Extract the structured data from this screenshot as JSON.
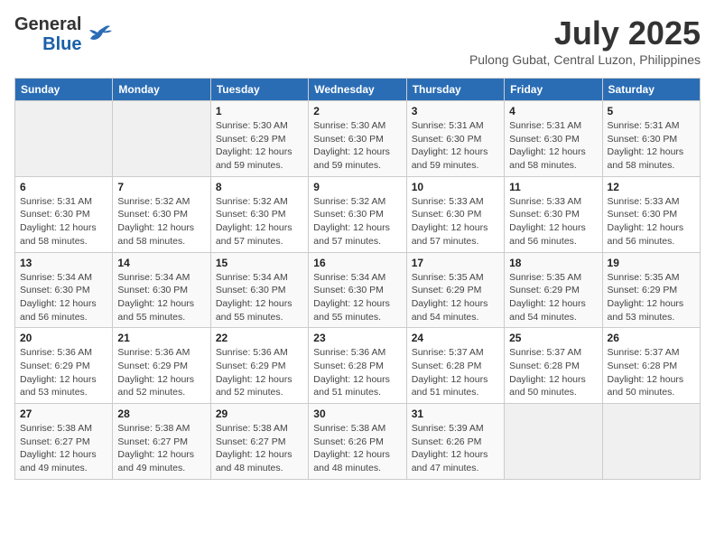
{
  "header": {
    "logo_line1": "General",
    "logo_line2": "Blue",
    "month_year": "July 2025",
    "location": "Pulong Gubat, Central Luzon, Philippines"
  },
  "days_of_week": [
    "Sunday",
    "Monday",
    "Tuesday",
    "Wednesday",
    "Thursday",
    "Friday",
    "Saturday"
  ],
  "weeks": [
    [
      {
        "day": "",
        "detail": ""
      },
      {
        "day": "",
        "detail": ""
      },
      {
        "day": "1",
        "detail": "Sunrise: 5:30 AM\nSunset: 6:29 PM\nDaylight: 12 hours\nand 59 minutes."
      },
      {
        "day": "2",
        "detail": "Sunrise: 5:30 AM\nSunset: 6:30 PM\nDaylight: 12 hours\nand 59 minutes."
      },
      {
        "day": "3",
        "detail": "Sunrise: 5:31 AM\nSunset: 6:30 PM\nDaylight: 12 hours\nand 59 minutes."
      },
      {
        "day": "4",
        "detail": "Sunrise: 5:31 AM\nSunset: 6:30 PM\nDaylight: 12 hours\nand 58 minutes."
      },
      {
        "day": "5",
        "detail": "Sunrise: 5:31 AM\nSunset: 6:30 PM\nDaylight: 12 hours\nand 58 minutes."
      }
    ],
    [
      {
        "day": "6",
        "detail": "Sunrise: 5:31 AM\nSunset: 6:30 PM\nDaylight: 12 hours\nand 58 minutes."
      },
      {
        "day": "7",
        "detail": "Sunrise: 5:32 AM\nSunset: 6:30 PM\nDaylight: 12 hours\nand 58 minutes."
      },
      {
        "day": "8",
        "detail": "Sunrise: 5:32 AM\nSunset: 6:30 PM\nDaylight: 12 hours\nand 57 minutes."
      },
      {
        "day": "9",
        "detail": "Sunrise: 5:32 AM\nSunset: 6:30 PM\nDaylight: 12 hours\nand 57 minutes."
      },
      {
        "day": "10",
        "detail": "Sunrise: 5:33 AM\nSunset: 6:30 PM\nDaylight: 12 hours\nand 57 minutes."
      },
      {
        "day": "11",
        "detail": "Sunrise: 5:33 AM\nSunset: 6:30 PM\nDaylight: 12 hours\nand 56 minutes."
      },
      {
        "day": "12",
        "detail": "Sunrise: 5:33 AM\nSunset: 6:30 PM\nDaylight: 12 hours\nand 56 minutes."
      }
    ],
    [
      {
        "day": "13",
        "detail": "Sunrise: 5:34 AM\nSunset: 6:30 PM\nDaylight: 12 hours\nand 56 minutes."
      },
      {
        "day": "14",
        "detail": "Sunrise: 5:34 AM\nSunset: 6:30 PM\nDaylight: 12 hours\nand 55 minutes."
      },
      {
        "day": "15",
        "detail": "Sunrise: 5:34 AM\nSunset: 6:30 PM\nDaylight: 12 hours\nand 55 minutes."
      },
      {
        "day": "16",
        "detail": "Sunrise: 5:34 AM\nSunset: 6:30 PM\nDaylight: 12 hours\nand 55 minutes."
      },
      {
        "day": "17",
        "detail": "Sunrise: 5:35 AM\nSunset: 6:29 PM\nDaylight: 12 hours\nand 54 minutes."
      },
      {
        "day": "18",
        "detail": "Sunrise: 5:35 AM\nSunset: 6:29 PM\nDaylight: 12 hours\nand 54 minutes."
      },
      {
        "day": "19",
        "detail": "Sunrise: 5:35 AM\nSunset: 6:29 PM\nDaylight: 12 hours\nand 53 minutes."
      }
    ],
    [
      {
        "day": "20",
        "detail": "Sunrise: 5:36 AM\nSunset: 6:29 PM\nDaylight: 12 hours\nand 53 minutes."
      },
      {
        "day": "21",
        "detail": "Sunrise: 5:36 AM\nSunset: 6:29 PM\nDaylight: 12 hours\nand 52 minutes."
      },
      {
        "day": "22",
        "detail": "Sunrise: 5:36 AM\nSunset: 6:29 PM\nDaylight: 12 hours\nand 52 minutes."
      },
      {
        "day": "23",
        "detail": "Sunrise: 5:36 AM\nSunset: 6:28 PM\nDaylight: 12 hours\nand 51 minutes."
      },
      {
        "day": "24",
        "detail": "Sunrise: 5:37 AM\nSunset: 6:28 PM\nDaylight: 12 hours\nand 51 minutes."
      },
      {
        "day": "25",
        "detail": "Sunrise: 5:37 AM\nSunset: 6:28 PM\nDaylight: 12 hours\nand 50 minutes."
      },
      {
        "day": "26",
        "detail": "Sunrise: 5:37 AM\nSunset: 6:28 PM\nDaylight: 12 hours\nand 50 minutes."
      }
    ],
    [
      {
        "day": "27",
        "detail": "Sunrise: 5:38 AM\nSunset: 6:27 PM\nDaylight: 12 hours\nand 49 minutes."
      },
      {
        "day": "28",
        "detail": "Sunrise: 5:38 AM\nSunset: 6:27 PM\nDaylight: 12 hours\nand 49 minutes."
      },
      {
        "day": "29",
        "detail": "Sunrise: 5:38 AM\nSunset: 6:27 PM\nDaylight: 12 hours\nand 48 minutes."
      },
      {
        "day": "30",
        "detail": "Sunrise: 5:38 AM\nSunset: 6:26 PM\nDaylight: 12 hours\nand 48 minutes."
      },
      {
        "day": "31",
        "detail": "Sunrise: 5:39 AM\nSunset: 6:26 PM\nDaylight: 12 hours\nand 47 minutes."
      },
      {
        "day": "",
        "detail": ""
      },
      {
        "day": "",
        "detail": ""
      }
    ]
  ]
}
